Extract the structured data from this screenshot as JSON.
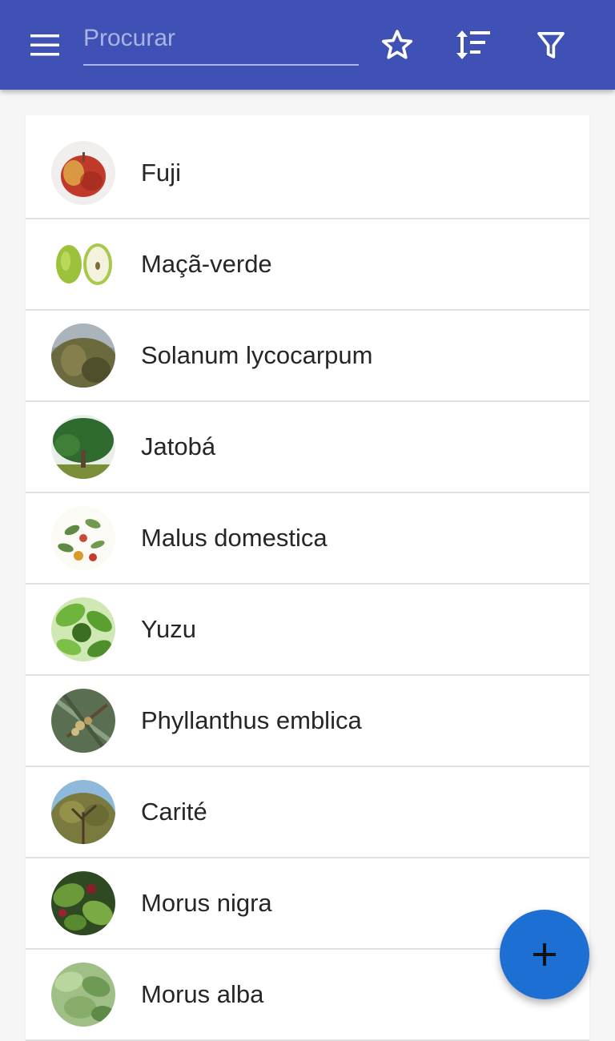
{
  "app_bar": {
    "background_color": "#3f51b5",
    "menu_icon": "hamburger-menu-icon",
    "search": {
      "placeholder": "Procurar",
      "value": ""
    },
    "actions": [
      {
        "icon": "star-outline-icon"
      },
      {
        "icon": "sort-icon"
      },
      {
        "icon": "filter-icon"
      }
    ]
  },
  "plants": [
    {
      "name": "Fuji",
      "image": "red-apple"
    },
    {
      "name": "Maçã-verde",
      "image": "green-apples"
    },
    {
      "name": "Solanum lycocarpum",
      "image": "shrub-under-cloudy-sky"
    },
    {
      "name": "Jatobá",
      "image": "tree-in-field"
    },
    {
      "name": "Malus domestica",
      "image": "botanical-illustration"
    },
    {
      "name": "Yuzu",
      "image": "green-citrus-leaves"
    },
    {
      "name": "Phyllanthus emblica",
      "image": "fruit-on-branch"
    },
    {
      "name": "Carité",
      "image": "tree-canopy"
    },
    {
      "name": "Morus nigra",
      "image": "mulberries-on-leaves"
    },
    {
      "name": "Morus alba",
      "image": "green-leaves"
    }
  ],
  "fab": {
    "icon": "plus-icon",
    "color": "#1e6fd4"
  }
}
